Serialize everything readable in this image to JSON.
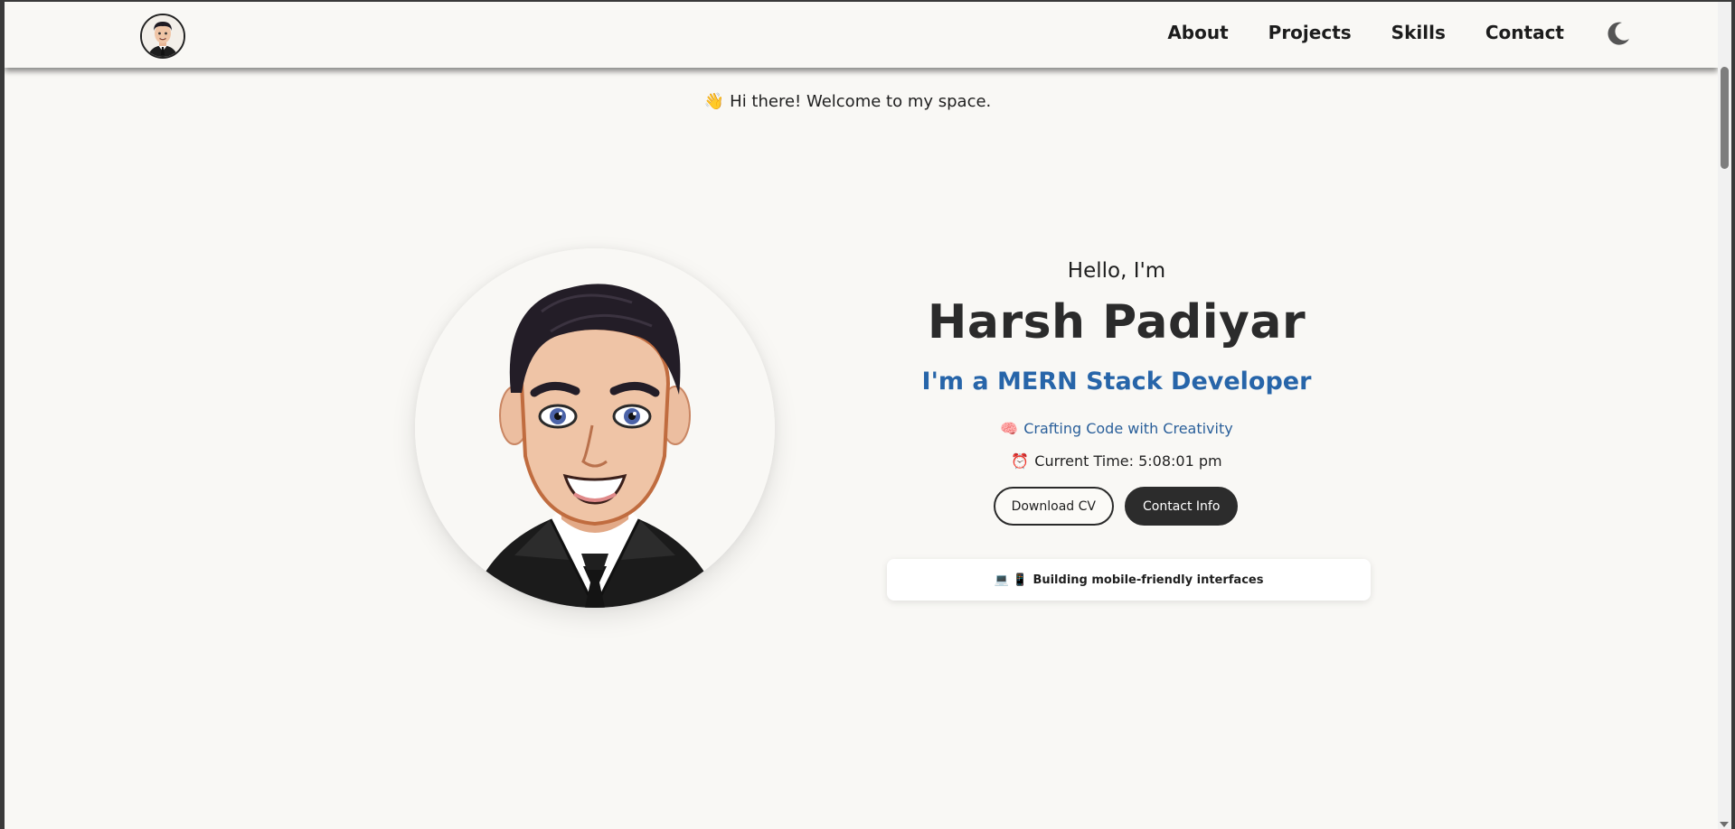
{
  "nav": {
    "links": [
      "About",
      "Projects",
      "Skills",
      "Contact"
    ]
  },
  "hero": {
    "welcome_emoji": "👋",
    "welcome_text": "Hi there! Welcome to my space.",
    "greeting": "Hello, I'm",
    "name": "Harsh Padiyar",
    "role": "I'm a MERN Stack Developer",
    "tagline_emoji": "🧠",
    "tagline": "Crafting Code with Creativity",
    "clock_emoji": "⏰",
    "clock_label": "Current Time: 5:08:01 pm",
    "buttons": {
      "download": "Download CV",
      "contact": "Contact Info"
    },
    "ticker_emoji": "💻 📱",
    "ticker_text": "Building mobile-friendly interfaces"
  },
  "icons": {
    "theme_toggle": "moon-icon",
    "nav_avatar": "avatar-icon"
  },
  "colors": {
    "background": "#f9f8f5",
    "accent_blue": "#2765a9",
    "dark": "#2c2c2c"
  }
}
